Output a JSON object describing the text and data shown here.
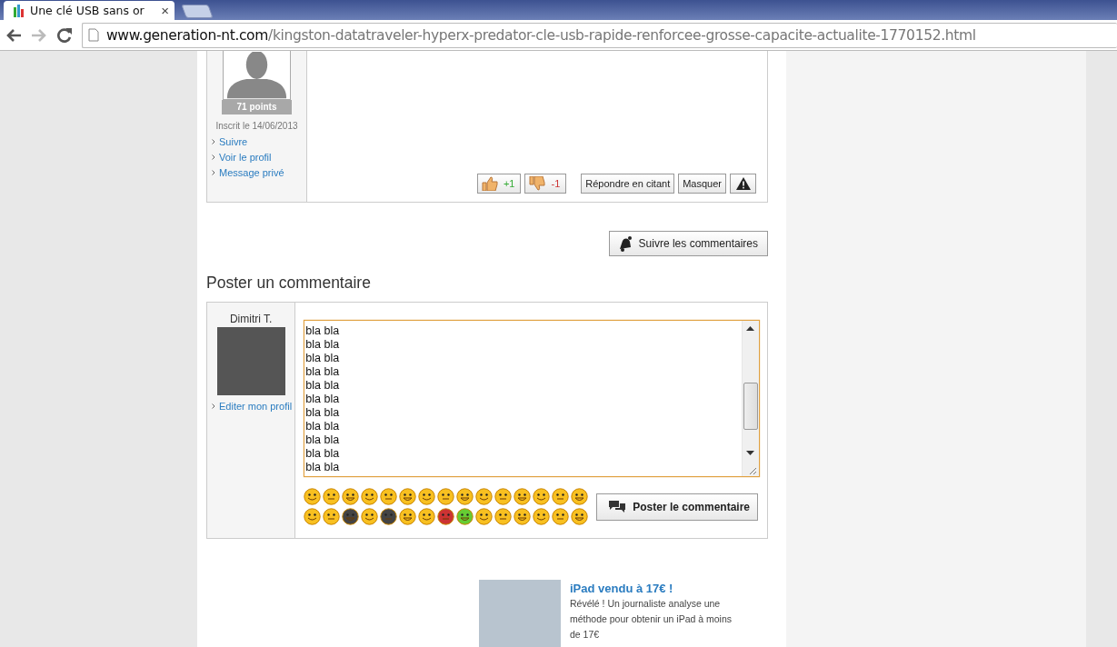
{
  "browser": {
    "tab": {
      "title": "Une clé USB sans or",
      "close": "×"
    },
    "url": {
      "domain": "www.generation-nt.com",
      "path": "/kingston-datatraveler-hyperx-predator-cle-usb-rapide-renforcee-grosse-capacite-actualite-1770152.html"
    }
  },
  "post": {
    "points": "71 points",
    "joined": "Inscrit le 14/06/2013",
    "links": [
      "Suivre",
      "Voir le profil",
      "Message privé"
    ],
    "like": "+1",
    "dislike": "-1",
    "buttons": [
      "Répondre en citant",
      "Masquer"
    ]
  },
  "follow_button": "Suivre les commentaires",
  "comment_form": {
    "heading": "Poster un commentaire",
    "user": "Dimitri T.",
    "profile_link": "Editer mon profil",
    "value": "bla bla\nbla bla\nbla bla\nbla bla\nbla bla\nbla bla\nbla bla\nbla bla\nbla bla\nbla bla\nbla bla",
    "submit": "Poster le commentaire"
  },
  "ad": {
    "title": "iPad vendu à 17€ !",
    "text": "Révélé ! Un journaliste analyse une méthode pour obtenir un iPad à moins de 17€"
  }
}
